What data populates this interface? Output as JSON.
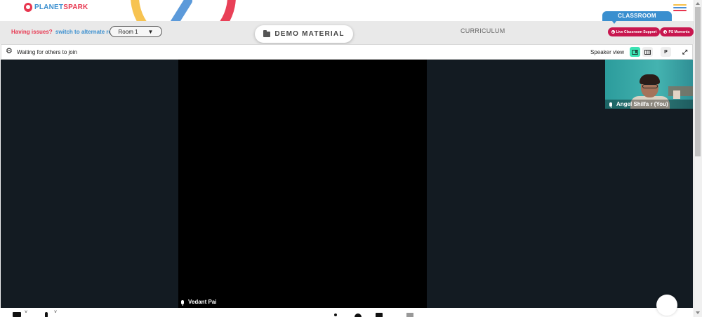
{
  "brand": {
    "name_part1": "PLANET",
    "name_part2": "SPARK",
    "colors": {
      "primary_red": "#e8364f",
      "primary_blue": "#3a8fcf",
      "accent_green": "#3ce3b4",
      "pill_crimson": "#c8174f"
    }
  },
  "header": {
    "menu_icon": "hamburger-menu-icon",
    "menu_line_colors": [
      "#f7c048",
      "#4a8fd6",
      "#e8364f"
    ]
  },
  "room_bar": {
    "issue_text": "Having issues?",
    "switch_link": "switch to alternate room",
    "room_selected": "Room 1",
    "room_caret": "▼",
    "demo_material_label": "DEMO MATERIAL",
    "curriculum_label": "CURRICULUM",
    "classroom_tab": "CLASSROOM",
    "live_support_label": "Live Classroom Support",
    "ps_moments_label": "PS Moments"
  },
  "video_header": {
    "settings_icon": "gear-icon",
    "status_text": "Waiting for others to join",
    "view_mode_label": "Speaker view",
    "layout_buttons": [
      "speaker-view-icon",
      "grid-view-icon"
    ],
    "p_button_label": "P",
    "expand_icon": "expand-icon",
    "expand_glyph": "⤢"
  },
  "participants": {
    "main": {
      "name": "Vedant Pai",
      "mic_icon": "microphone-icon"
    },
    "self": {
      "name": "Angel Shilfa r (You)",
      "mic_icon": "microphone-icon"
    }
  },
  "toolbar": {
    "caret_glyph": "˅",
    "items": [
      "camera-icon",
      "microphone-icon",
      "info-icon",
      "record-icon",
      "share-screen-icon",
      "whiteboard-icon",
      "chat-bubble-icon"
    ]
  }
}
